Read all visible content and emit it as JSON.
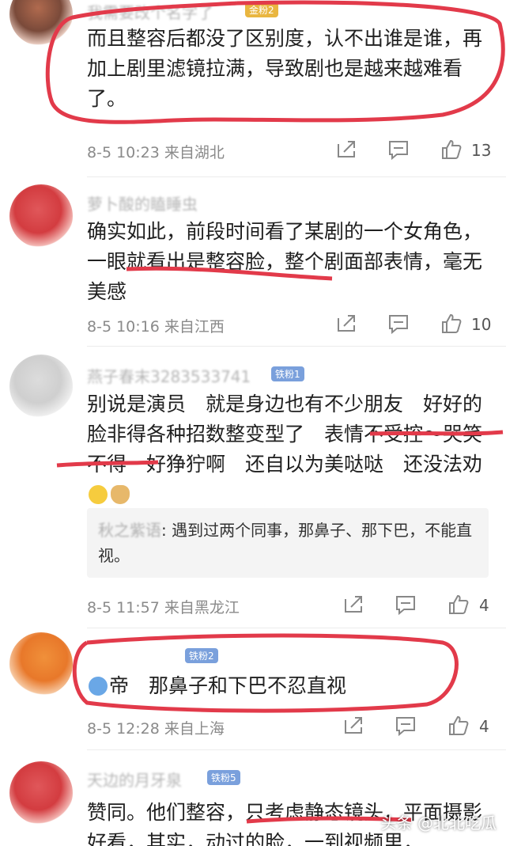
{
  "comments": [
    {
      "user": "我需要改个名字了",
      "badge": "金粉2",
      "text": "而且整容后都没了区别度，认不出谁是谁，再加上剧里滤镜拉满，导致剧也是越来越难看了。",
      "time": "8-5 10:23",
      "location": "来自湖北",
      "likes": "13"
    },
    {
      "user": "萝卜酸的瞌睡虫",
      "badge": "",
      "text": "确实如此，前段时间看了某剧的一个女角色，一眼就看出是整容脸，整个剧面部表情，毫无美感",
      "time": "8-5 10:16",
      "location": "来自江西",
      "likes": "10"
    },
    {
      "user": "燕子春末3283533741",
      "badge": "铁粉1",
      "text": "别说是演员　就是身边也有不少朋友　好好的脸非得各种招数整变型了　表情不受控～哭笑不得　好狰狞啊　还自以为美哒哒　还没法劝",
      "reply_user": "秋之紫语",
      "reply_text": "遇到过两个同事，那鼻子、那下巴，不能直视。",
      "time": "8-5 11:57",
      "location": "来自黑龙江",
      "likes": "4"
    },
    {
      "user": "",
      "badge": "铁粉2",
      "text": "帝　那鼻子和下巴不忍直视",
      "time": "8-5 12:28",
      "location": "来自上海",
      "likes": "4"
    },
    {
      "user": "天边的月牙泉",
      "badge": "铁粉5",
      "text": "赞同。他们整容，只考虑静态镜头，平面摄影好看，其实，动过的脸，一到视频里，"
    }
  ],
  "icons": {
    "repost": "repost-icon",
    "comment": "comment-icon",
    "like": "thumbs-up-icon"
  },
  "watermark": "头条 @北北吃瓜",
  "colors": {
    "annotation": "#e23a4a",
    "badge_iron": "#7aa0dc",
    "badge_gold": "#e9b640"
  }
}
